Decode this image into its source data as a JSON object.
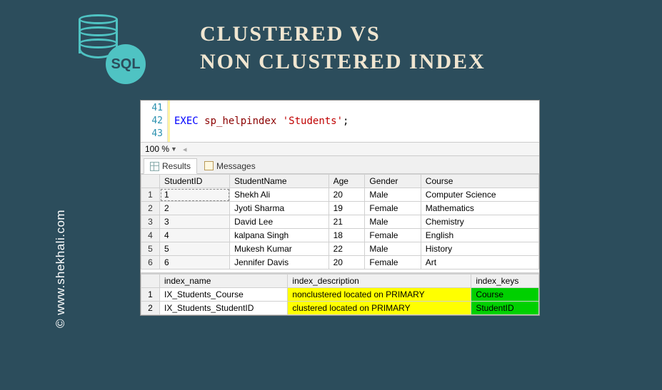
{
  "logo": {
    "badge_text": "SQL"
  },
  "title": {
    "line1": "CLUSTERED VS",
    "line2": "NON CLUSTERED INDEX"
  },
  "copyright": "© www.shekhali.com",
  "code": {
    "lines": [
      {
        "num": "41",
        "text": ""
      },
      {
        "num": "42",
        "kw": "EXEC",
        "sp": "sp_helpindex",
        "str": "'Students'",
        "semi": ";"
      },
      {
        "num": "43",
        "text": ""
      }
    ]
  },
  "zoom": {
    "value": "100 %"
  },
  "tabs": {
    "results": "Results",
    "messages": "Messages"
  },
  "students": {
    "headers": [
      "StudentID",
      "StudentName",
      "Age",
      "Gender",
      "Course"
    ],
    "rows": [
      {
        "n": "1",
        "c": [
          "1",
          "Shekh Ali",
          "20",
          "Male",
          "Computer Science"
        ]
      },
      {
        "n": "2",
        "c": [
          "2",
          "Jyoti Sharma",
          "19",
          "Female",
          "Mathematics"
        ]
      },
      {
        "n": "3",
        "c": [
          "3",
          "David Lee",
          "21",
          "Male",
          "Chemistry"
        ]
      },
      {
        "n": "4",
        "c": [
          "4",
          "kalpana Singh",
          "18",
          "Female",
          "English"
        ]
      },
      {
        "n": "5",
        "c": [
          "5",
          "Mukesh Kumar",
          "22",
          "Male",
          "History"
        ]
      },
      {
        "n": "6",
        "c": [
          "6",
          "Jennifer Davis",
          "20",
          "Female",
          "Art"
        ]
      }
    ]
  },
  "indexes": {
    "headers": [
      "index_name",
      "index_description",
      "index_keys"
    ],
    "rows": [
      {
        "n": "1",
        "c": [
          "IX_Students_Course",
          "nonclustered located on PRIMARY",
          "Course"
        ]
      },
      {
        "n": "2",
        "c": [
          "IX_Students_StudentID",
          "clustered located on PRIMARY",
          "StudentID"
        ]
      }
    ]
  }
}
